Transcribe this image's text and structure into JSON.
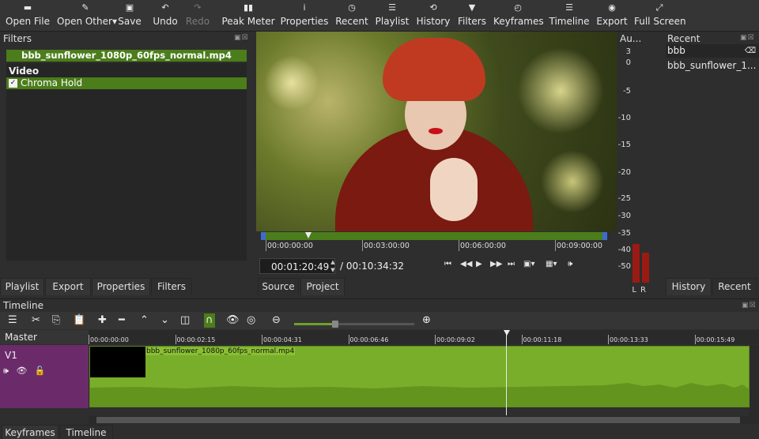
{
  "toolbar": {
    "open_file": "Open File",
    "open_other": "Open Other",
    "save": "Save",
    "undo": "Undo",
    "redo": "Redo",
    "peak_meter": "Peak Meter",
    "properties": "Properties",
    "recent": "Recent",
    "playlist": "Playlist",
    "history": "History",
    "filters": "Filters",
    "keyframes": "Keyframes",
    "timeline": "Timeline",
    "export": "Export",
    "full_screen": "Full Screen"
  },
  "filters_panel": {
    "title": "Filters",
    "clip_name": "bbb_sunflower_1080p_60fps_normal.mp4",
    "section": "Video",
    "filters": [
      {
        "name": "Chroma Hold",
        "enabled": true
      }
    ],
    "tabs": [
      "Playlist",
      "Export",
      "Properties",
      "Filters"
    ],
    "active_tab": "Filters"
  },
  "player": {
    "ruler_labels": [
      "00:00:00:00",
      "00:03:00:00",
      "00:06:00:00",
      "00:09:00:00"
    ],
    "current_time": "00:01:20:49",
    "total_time": "/ 00:10:34:32",
    "tabs": [
      "Source",
      "Project"
    ],
    "active_tab": "Source"
  },
  "audio_meter": {
    "title": "Au...",
    "scale": [
      "3",
      "0",
      "-5",
      "-10",
      "-15",
      "-20",
      "-25",
      "-30",
      "-35",
      "-40",
      "-50"
    ],
    "channels": [
      "L",
      "R"
    ],
    "levels_db": [
      -29,
      -34
    ]
  },
  "recent_panel": {
    "title": "Recent",
    "search_value": "bbb",
    "items": [
      "bbb_sunflower_1..."
    ],
    "tabs": [
      "History",
      "Recent"
    ],
    "active_tab": "Recent"
  },
  "timeline": {
    "title": "Timeline",
    "master_label": "Master",
    "ruler_labels": [
      "00:00:00:00",
      "00:00:02:15",
      "00:00:04:31",
      "00:00:06:46",
      "00:00:09:02",
      "00:00:11:18",
      "00:00:13:33",
      "00:00:15:49"
    ],
    "tracks": [
      {
        "name": "V1",
        "clip": "bbb_sunflower_1080p_60fps_normal.mp4"
      }
    ],
    "zoom_fraction": 0.34,
    "bottom_tabs": [
      "Keyframes",
      "Timeline"
    ],
    "active_tab": "Timeline"
  },
  "colors": {
    "accent_green": "#4b7d1b",
    "clip_green": "#79ae2a",
    "track_purple": "#6b2b6b",
    "meter_red": "#9a1a14"
  }
}
